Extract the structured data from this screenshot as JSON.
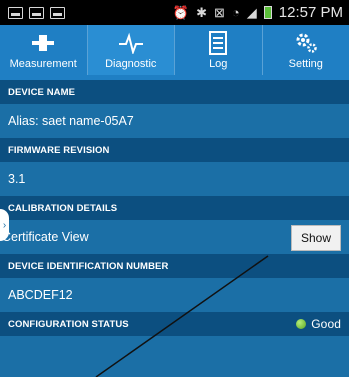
{
  "status_bar": {
    "time": "12:57 PM"
  },
  "tabs": [
    {
      "label": "Measurement",
      "icon": "measurement-icon"
    },
    {
      "label": "Diagnostic",
      "icon": "diagnostic-icon",
      "active": true
    },
    {
      "label": "Log",
      "icon": "log-icon"
    },
    {
      "label": "Setting",
      "icon": "gear-icon"
    }
  ],
  "sections": {
    "device_name": {
      "header": "DEVICE NAME",
      "value": "Alias: saet name-05A7"
    },
    "firmware": {
      "header": "FIRMWARE REVISION",
      "value": "3.1"
    },
    "calibration": {
      "header": "CALIBRATION DETAILS",
      "value": "Certificate View",
      "button": "Show"
    },
    "device_id": {
      "header": "DEVICE IDENTIFICATION NUMBER",
      "value": "ABCDEF12"
    },
    "config": {
      "header": "CONFIGURATION STATUS",
      "status": "Good",
      "status_color": "#7ed957"
    }
  },
  "colors": {
    "tabbar": "#1f7fc4",
    "header": "#0c4f80",
    "body": "#1b6fa6"
  }
}
